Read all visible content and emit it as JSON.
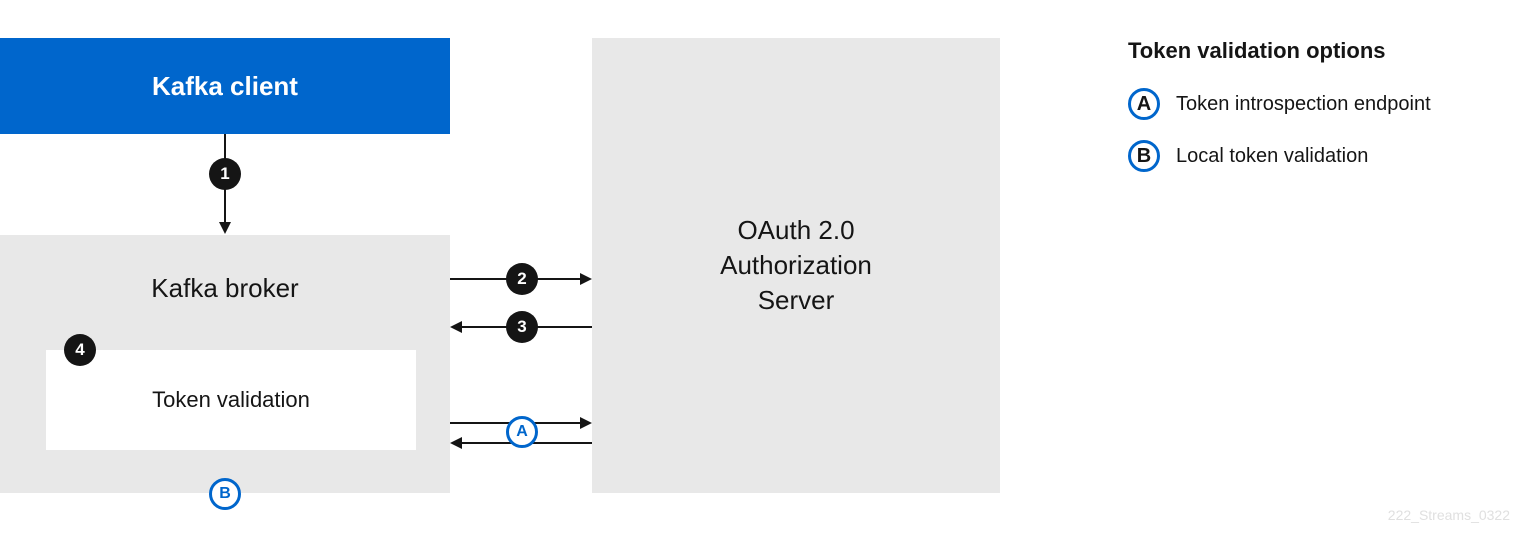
{
  "boxes": {
    "kafka_client": "Kafka client",
    "kafka_broker": "Kafka broker",
    "token_validation": "Token validation",
    "oauth_server_line1": "OAuth 2.0",
    "oauth_server_line2": "Authorization",
    "oauth_server_line3": "Server"
  },
  "steps": {
    "s1": "1",
    "s2": "2",
    "s3": "3",
    "s4": "4"
  },
  "options": {
    "a": "A",
    "b": "B"
  },
  "legend": {
    "title": "Token validation options",
    "item_a": "Token introspection endpoint",
    "item_b": "Local token validation"
  },
  "watermark": "222_Streams_0322"
}
